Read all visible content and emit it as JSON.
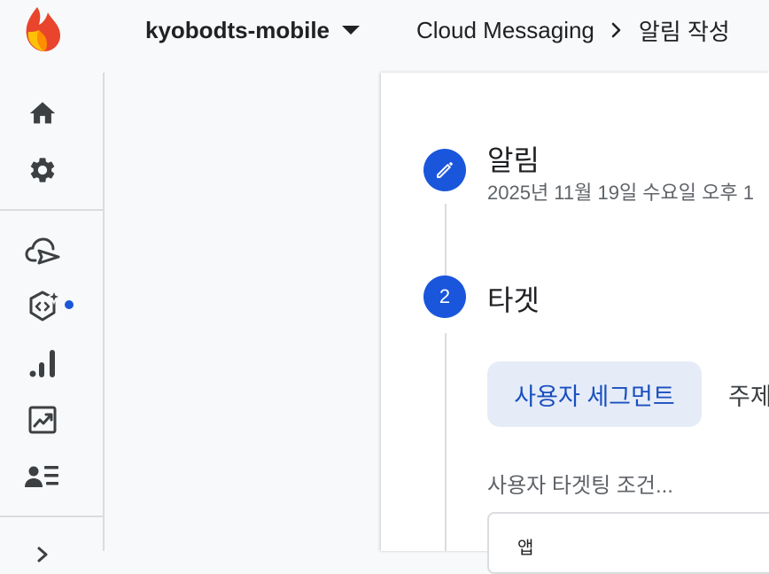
{
  "header": {
    "project_name": "kyobodts-mobile",
    "breadcrumb": {
      "section": "Cloud Messaging",
      "separator": ">",
      "current": "알림 작성"
    },
    "logo_icon": "firebase-flame-icon"
  },
  "sidebar": {
    "items": [
      {
        "icon": "home-icon"
      },
      {
        "icon": "gear-icon"
      },
      {
        "icon": "cloud-send-icon"
      },
      {
        "icon": "ai-code-sparkle-icon",
        "has_badge": true
      },
      {
        "icon": "bar-chart-icon"
      },
      {
        "icon": "trending-chart-icon"
      },
      {
        "icon": "person-list-icon"
      },
      {
        "icon": "chevron-right-icon"
      }
    ]
  },
  "steps": {
    "step1": {
      "icon": "pencil-icon",
      "title": "알림",
      "subtitle": "2025년 11월 19일 수요일 오후 1"
    },
    "step2": {
      "number": "2",
      "title": "타겟",
      "tabs": [
        "사용자 세그먼트",
        "주제"
      ],
      "selected_tab": "사용자 세그먼트",
      "condition_label": "사용자 타겟팅 조건...",
      "field_value": "앱"
    }
  },
  "colors": {
    "accent": "#1a56db",
    "chip_bg": "#e5ecf8",
    "chip_text": "#1a4fbf",
    "flame_orange": "#e8452c",
    "flame_yellow": "#ffc107"
  }
}
